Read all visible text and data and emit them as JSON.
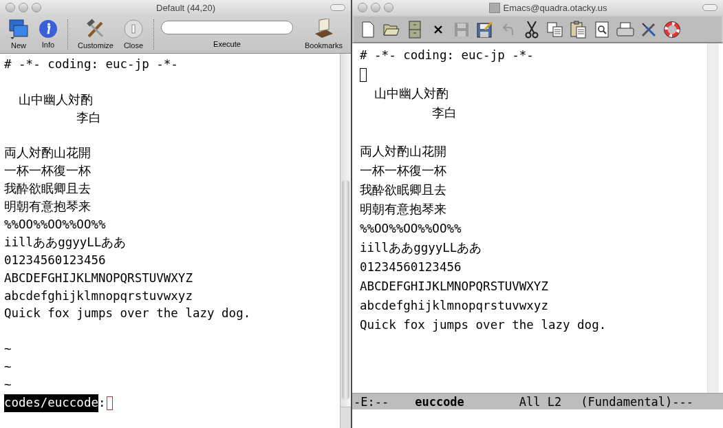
{
  "left_window": {
    "title": "Default (44,20)",
    "toolbar": [
      {
        "kind": "new",
        "label": "New"
      },
      {
        "kind": "info",
        "label": "Info"
      },
      {
        "kind": "separator"
      },
      {
        "kind": "customize",
        "label": "Customize"
      },
      {
        "kind": "close",
        "label": "Close"
      },
      {
        "kind": "separator"
      },
      {
        "kind": "field",
        "label": "Execute"
      },
      {
        "kind": "bookmarks",
        "label": "Bookmarks"
      }
    ],
    "lines": [
      {
        "kind": "text",
        "text": "# -*- coding: euc-jp -*-"
      },
      {
        "kind": "blank"
      },
      {
        "kind": "text",
        "text": "  山中幽人対酌"
      },
      {
        "kind": "text",
        "text": "          李白"
      },
      {
        "kind": "blank"
      },
      {
        "kind": "text",
        "text": "両人対酌山花開"
      },
      {
        "kind": "text",
        "text": "一杯一杯復一杯"
      },
      {
        "kind": "text",
        "text": "我酔欲眠卿且去"
      },
      {
        "kind": "text",
        "text": "明朝有意抱琴来"
      },
      {
        "kind": "text",
        "text": "%%OO%%OO%%OO%%"
      },
      {
        "kind": "text",
        "text": "iillああggyyLLああ"
      },
      {
        "kind": "text",
        "text": "01234560123456"
      },
      {
        "kind": "text",
        "text": "ABCDEFGHIJKLMNOPQRSTUVWXYZ"
      },
      {
        "kind": "text",
        "text": "abcdefghijklmnopqrstuvwxyz"
      },
      {
        "kind": "text",
        "text": "Quick fox jumps over the lazy dog."
      },
      {
        "kind": "blank"
      },
      {
        "kind": "tilde",
        "text": "~"
      },
      {
        "kind": "tilde",
        "text": "~"
      },
      {
        "kind": "tilde",
        "text": "~"
      }
    ],
    "prompt": {
      "path": "codes/euccode",
      "separator": ":"
    }
  },
  "right_window": {
    "title": "Emacs@quadra.otacky.us",
    "toolbar": [
      {
        "kind": "new-file",
        "disabled": false
      },
      {
        "kind": "open-folder",
        "disabled": false
      },
      {
        "kind": "cabinet",
        "disabled": false
      },
      {
        "kind": "cross",
        "disabled": false
      },
      {
        "kind": "save",
        "disabled": true
      },
      {
        "kind": "save-as",
        "disabled": false
      },
      {
        "kind": "undo",
        "disabled": true
      },
      {
        "kind": "cut",
        "disabled": false
      },
      {
        "kind": "copy",
        "disabled": false
      },
      {
        "kind": "paste",
        "disabled": false
      },
      {
        "kind": "search",
        "disabled": false
      },
      {
        "kind": "print",
        "disabled": false
      },
      {
        "kind": "tools",
        "disabled": false
      },
      {
        "kind": "help",
        "disabled": false
      }
    ],
    "lines": [
      {
        "kind": "text",
        "text": "# -*- coding: euc-jp -*-"
      },
      {
        "kind": "cursor"
      },
      {
        "kind": "text",
        "text": "  山中幽人対酌"
      },
      {
        "kind": "text",
        "text": "          李白"
      },
      {
        "kind": "blank"
      },
      {
        "kind": "text",
        "text": "両人対酌山花開"
      },
      {
        "kind": "text",
        "text": "一杯一杯復一杯"
      },
      {
        "kind": "text",
        "text": "我酔欲眠卿且去"
      },
      {
        "kind": "text",
        "text": "明朝有意抱琴来"
      },
      {
        "kind": "text",
        "text": "%%OO%%OO%%OO%%"
      },
      {
        "kind": "text",
        "text": "iillああggyyLLああ"
      },
      {
        "kind": "text",
        "text": "01234560123456"
      },
      {
        "kind": "text",
        "text": "ABCDEFGHIJKLMNOPQRSTUVWXYZ"
      },
      {
        "kind": "text",
        "text": "abcdefghijklmnopqrstuvwxyz"
      },
      {
        "kind": "text",
        "text": "Quick fox jumps over the lazy dog."
      }
    ],
    "mode_line": {
      "status": "-E:--",
      "buffer": "euccode",
      "position": "All L2",
      "mode": "(Fundamental)---"
    }
  }
}
